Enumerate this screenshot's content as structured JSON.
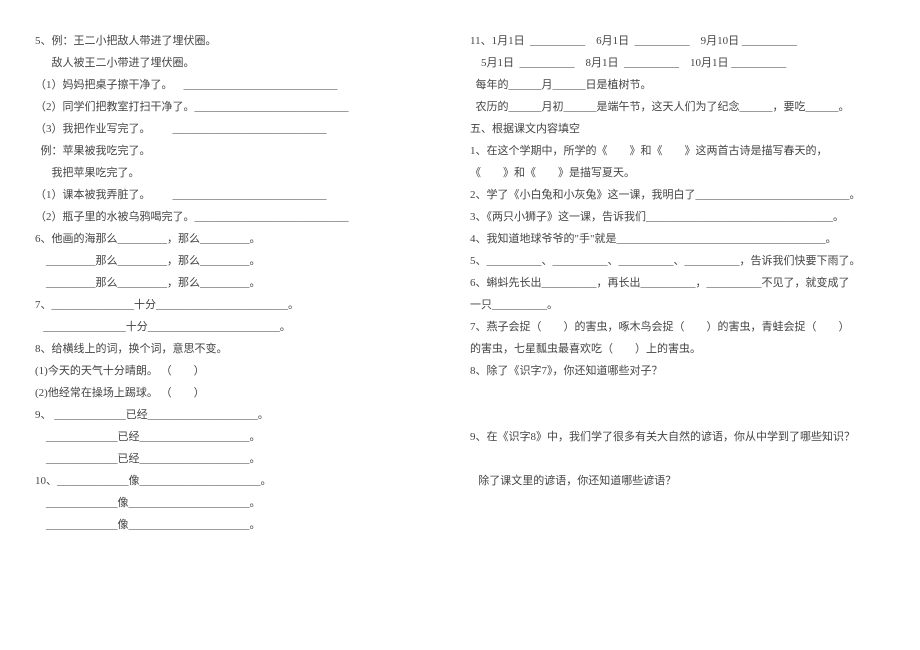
{
  "left": {
    "l1": "5、例：王二小把敌人带进了埋伏圈。",
    "l2": "      敌人被王二小带进了埋伏圈。",
    "l3": "（1）妈妈把桌子擦干净了。    ____________________________",
    "l4": "（2）同学们把教室打扫干净了。____________________________",
    "l5": "（3）我把作业写完了。        ____________________________",
    "l6": "  例：苹果被我吃完了。",
    "l7": "      我把苹果吃完了。",
    "l8": "（1）课本被我弄脏了。        ____________________________",
    "l9": "（2）瓶子里的水被乌鸦喝完了。____________________________",
    "l10": "6、他画的海那么_________，那么_________。",
    "l11": "    _________那么_________，那么_________。",
    "l12": "    _________那么_________，那么_________。",
    "l13": "7、_______________十分________________________。",
    "l14": "   _______________十分________________________。",
    "l15": "8、给横线上的词，换个词，意思不变。",
    "l16": "(1)今天的天气十分晴朗。 （        ）",
    "l17": "(2)他经常在操场上踢球。 （        ）",
    "l18": "9、 _____________已经____________________。",
    "l19": "    _____________已经____________________。",
    "l20": "    _____________已经____________________。",
    "l21": "10、_____________像______________________。",
    "l22": "    _____________像______________________。",
    "l23": "    _____________像______________________。"
  },
  "right": {
    "r1": "11、1月1日  __________    6月1日  __________    9月10日 __________",
    "r2": "    5月1日  __________    8月1日  __________    10月1日 __________",
    "r3": "  每年的______月______日是植树节。",
    "r4": "  农历的______月初______是端午节，这天人们为了纪念______，要吃______。",
    "r5": "五、根据课文内容填空",
    "r6": "1、在这个学期中，所学的《        》和《        》这两首古诗是描写春天的，",
    "r7": "《        》和《        》是描写夏天。",
    "r8": "2、学了《小白兔和小灰兔》这一课，我明白了____________________________。",
    "r9": "3、《两只小狮子》这一课，告诉我们__________________________________。",
    "r10": "4、我知道地球爷爷的\"手\"就是______________________________________。",
    "r11": "5、__________、__________、__________、__________，告诉我们快要下雨了。",
    "r12": "6、蝌蚪先长出__________，再长出__________，__________不见了，就变成了",
    "r13": "一只__________。",
    "r14": "7、燕子会捉（        ）的害虫，啄木鸟会捉（        ）的害虫，青蛙会捉（        ）",
    "r15": "的害虫，七星瓢虫最喜欢吃（        ）上的害虫。",
    "r16": "8、除了《识字7》，你还知道哪些对子？",
    "r17": " ",
    "r18": " ",
    "r19": "9、在《识字8》中，我们学了很多有关大自然的谚语，你从中学到了哪些知识？",
    "r20": " ",
    "r21": "   除了课文里的谚语，你还知道哪些谚语？",
    "r22": " ",
    "r23": " "
  }
}
